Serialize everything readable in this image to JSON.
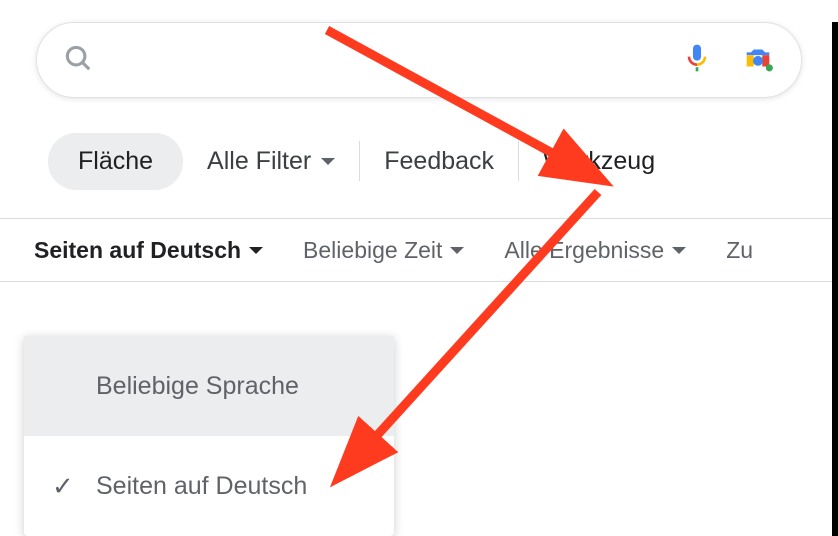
{
  "search": {
    "placeholder": ""
  },
  "filters": {
    "flache": "Fläche",
    "alle_filter": "Alle Filter",
    "feedback": "Feedback",
    "werkzeug": "Werkzeug"
  },
  "tools": {
    "language": "Seiten auf Deutsch",
    "time": "Beliebige Zeit",
    "results": "Alle Ergebnisse",
    "reset_partial": "Zu"
  },
  "dropdown": {
    "any_language": "Beliebige Sprache",
    "german_pages": "Seiten auf Deutsch"
  }
}
